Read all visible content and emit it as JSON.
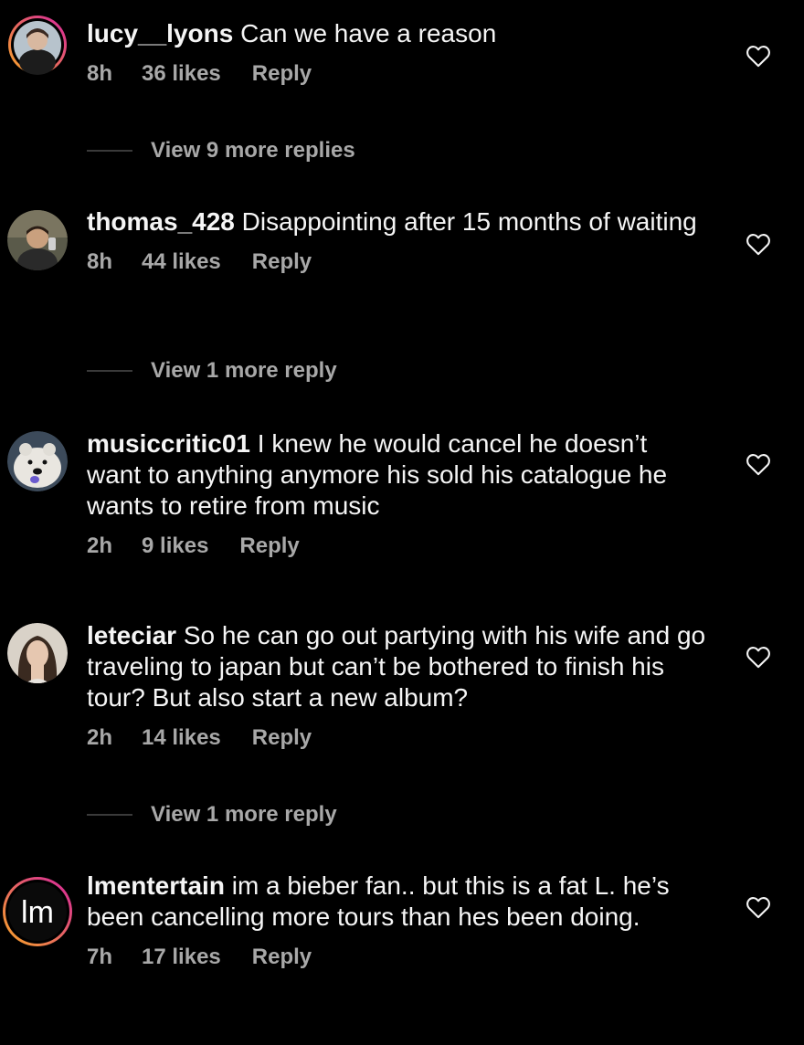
{
  "comments": [
    {
      "username": "lucy__lyons",
      "text": "Can we have a reason",
      "time": "8h",
      "likes": "36 likes",
      "reply": "Reply",
      "view_more": "View 9 more replies",
      "avatar": "avatar-person-dark"
    },
    {
      "username": "thomas_428",
      "text": "Disappointing after 15 months of waiting",
      "time": "8h",
      "likes": "44 likes",
      "reply": "Reply",
      "view_more": "View 1 more reply",
      "avatar": "avatar-person-smiling"
    },
    {
      "username": "musiccritic01",
      "text": "I knew he would cancel he doesn’t want to anything anymore his sold his catalogue he wants to retire from music",
      "time": "2h",
      "likes": "9 likes",
      "reply": "Reply",
      "avatar": "avatar-polar-bear"
    },
    {
      "username": "leteciar",
      "text": "So he can go out partying with his wife and go traveling to japan but can’t be bothered to finish his tour? But also start a new album?",
      "time": "2h",
      "likes": "14 likes",
      "reply": "Reply",
      "view_more": "View 1 more reply",
      "avatar": "avatar-woman-portrait"
    },
    {
      "username": "lmentertain",
      "text": "im a bieber fan.. but this is a fat L. he’s been cancelling more tours than hes been doing.",
      "time": "7h",
      "likes": "17 likes",
      "reply": "Reply",
      "avatar": "avatar-lm-logo",
      "avatar_logo_text": "lm"
    }
  ],
  "colors": {
    "background": "#000000",
    "primary_text": "#f5f5f5",
    "secondary_text": "#a8a8a8",
    "story_ring_start": "#f9a825",
    "story_ring_end": "#d6249f"
  },
  "icons": {
    "like": "heart-outline-icon"
  }
}
